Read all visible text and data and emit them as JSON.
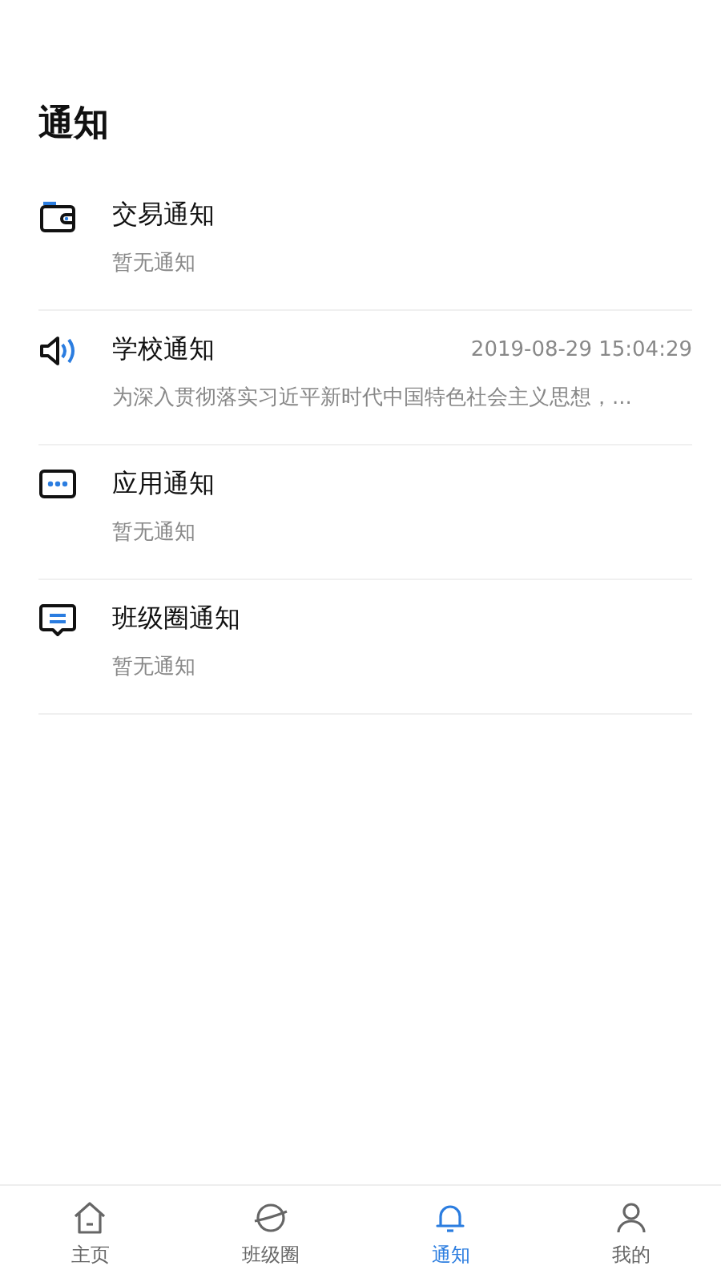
{
  "title": "通知",
  "notifications": [
    {
      "kind": "wallet",
      "name": "交易通知",
      "summary": "暂无通知"
    },
    {
      "kind": "speaker",
      "name": "学校通知",
      "time": "2019-08-29 15:04:29",
      "summary": "为深入贯彻落实习近平新时代中国特色社会主义思想，..."
    },
    {
      "kind": "dots",
      "name": "应用通知",
      "summary": "暂无通知"
    },
    {
      "kind": "chat",
      "name": "班级圈通知",
      "summary": "暂无通知"
    }
  ],
  "tabs": [
    {
      "kind": "home",
      "label": "主页",
      "selected": false
    },
    {
      "kind": "planet",
      "label": "班级圈",
      "selected": false
    },
    {
      "kind": "bell",
      "label": "通知",
      "selected": true
    },
    {
      "kind": "person",
      "label": "我的",
      "selected": false
    }
  ]
}
